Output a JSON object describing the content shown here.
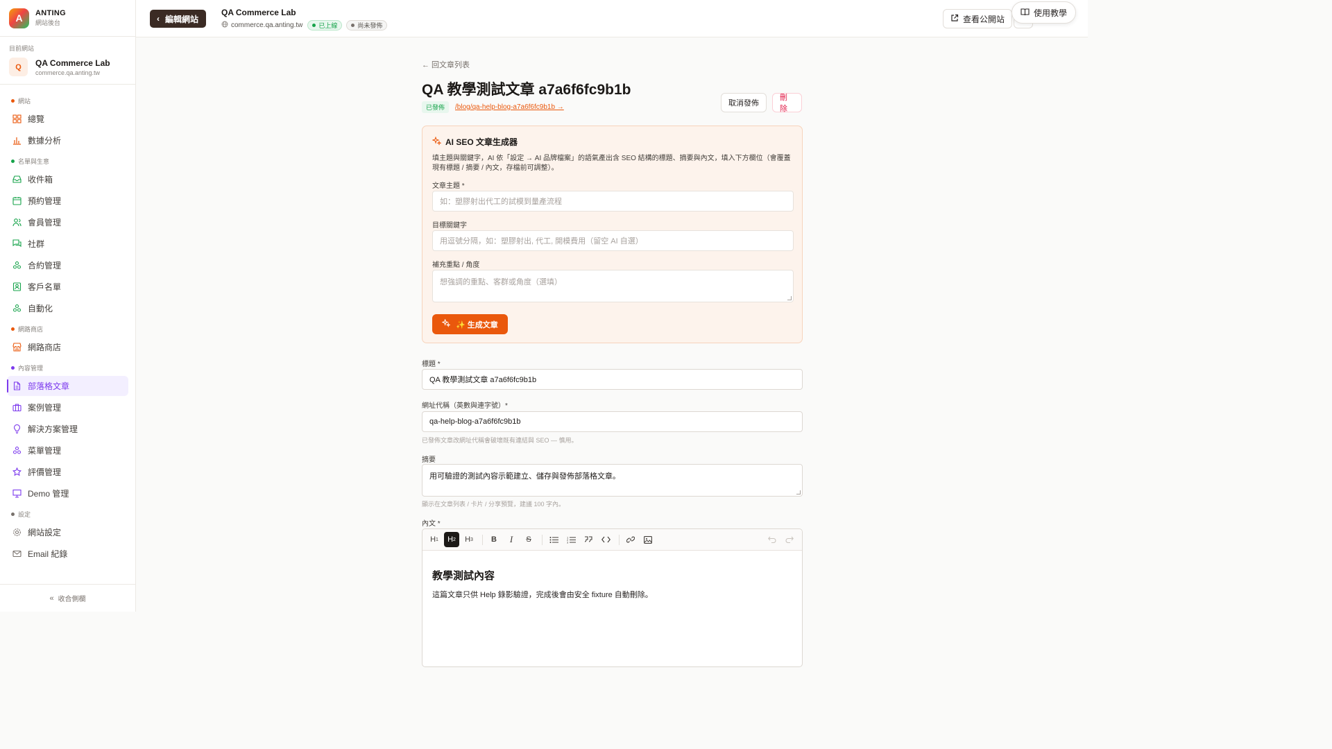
{
  "brand": {
    "logo_letter": "A",
    "name": "ANTING",
    "sub": "網站後台"
  },
  "current_site": {
    "label": "目前網站",
    "avatar": "Q",
    "name": "QA Commerce Lab",
    "domain": "commerce.qa.anting.tw"
  },
  "nav_groups": [
    {
      "label": "網站",
      "color": "#ea580c",
      "items": [
        {
          "label": "總覽",
          "icon": "grid-icon"
        },
        {
          "label": "數據分析",
          "icon": "bar-chart-icon"
        }
      ]
    },
    {
      "label": "名單與生意",
      "color": "#16a34a",
      "items": [
        {
          "label": "收件箱",
          "icon": "inbox-icon"
        },
        {
          "label": "預約管理",
          "icon": "calendar-icon"
        },
        {
          "label": "會員管理",
          "icon": "users-icon"
        },
        {
          "label": "社群",
          "icon": "chat-icon"
        },
        {
          "label": "合約管理",
          "icon": "contract-icon"
        },
        {
          "label": "客戶名單",
          "icon": "contacts-icon"
        },
        {
          "label": "自動化",
          "icon": "automation-icon"
        }
      ]
    },
    {
      "label": "網路商店",
      "color": "#ea580c",
      "items": [
        {
          "label": "網路商店",
          "icon": "store-icon"
        }
      ]
    },
    {
      "label": "內容管理",
      "color": "#7c3aed",
      "items": [
        {
          "label": "部落格文章",
          "icon": "document-icon",
          "active": true
        },
        {
          "label": "案例管理",
          "icon": "briefcase-icon"
        },
        {
          "label": "解決方案管理",
          "icon": "lightbulb-icon"
        },
        {
          "label": "菜單管理",
          "icon": "menu-icon"
        },
        {
          "label": "評價管理",
          "icon": "star-icon"
        },
        {
          "label": "Demo 管理",
          "icon": "presentation-icon"
        }
      ]
    },
    {
      "label": "設定",
      "color": "#78716c",
      "items": [
        {
          "label": "網站設定",
          "icon": "gear-icon"
        },
        {
          "label": "Email 紀錄",
          "icon": "mail-icon"
        }
      ]
    }
  ],
  "collapse_label": "收合側欄",
  "header": {
    "back_label": "編輯網站",
    "site_name": "QA Commerce Lab",
    "domain": "commerce.qa.anting.tw",
    "badge_live": "已上線",
    "badge_unpub": "尚未發佈",
    "view_site": "查看公開站",
    "help": "使用教學"
  },
  "article": {
    "back_link": "← 回文章列表",
    "title": "QA 教學測試文章 a7a6f6fc9b1b",
    "status": "已發佈",
    "url": "/blog/qa-help-blog-a7a6f6fc9b1b →",
    "unpublish": "取消發佈",
    "delete": "刪除"
  },
  "ai": {
    "title": "AI SEO 文章生成器",
    "desc": "填主題與關鍵字，AI 依「設定 → AI 品牌檔案」的語氣產出含 SEO 結構的標題、摘要與內文，填入下方欄位（會覆蓋現有標題 / 摘要 / 內文，存檔前可調整）。",
    "topic_label": "文章主題 *",
    "topic_placeholder": "如：塑膠射出代工的試模到量產流程",
    "kw_label": "目標關鍵字",
    "kw_placeholder": "用逗號分隔，如：塑膠射出, 代工, 開模費用（留空 AI 自選）",
    "angle_label": "補充重點 / 角度",
    "angle_placeholder": "想強調的重點、客群或角度（選填）",
    "generate": "✨ 生成文章"
  },
  "form": {
    "title_label": "標題 *",
    "title_value": "QA 教學測試文章 a7a6f6fc9b1b",
    "slug_label": "網址代稱（英數與連字號）*",
    "slug_value": "qa-help-blog-a7a6f6fc9b1b",
    "slug_hint": "已發佈文章改網址代稱會破壞既有連結與 SEO — 慎用。",
    "summary_label": "摘要",
    "summary_value": "用可驗證的測試內容示範建立、儲存與發佈部落格文章。",
    "summary_hint": "顯示在文章列表 / 卡片 / 分享預覽，建議 100 字內。",
    "body_label": "內文 *"
  },
  "editor": {
    "heading": "教學測試內容",
    "paragraph": "這篇文章只供 Help 錄影驗證，完成後會由安全 fixture 自動刪除。"
  }
}
